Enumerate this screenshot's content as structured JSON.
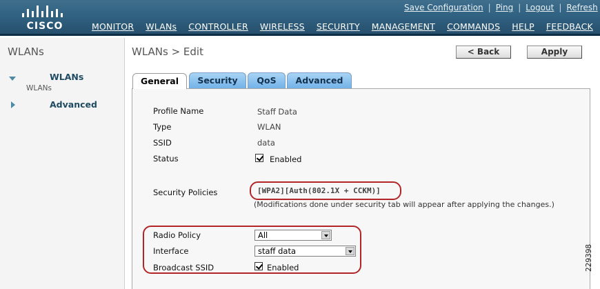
{
  "brand": {
    "logo_text": "CISCO"
  },
  "utility_links": [
    "Save Configuration",
    "Ping",
    "Logout",
    "Refresh"
  ],
  "main_nav": {
    "items": [
      "MONITOR",
      "WLANs",
      "CONTROLLER",
      "WIRELESS",
      "SECURITY",
      "MANAGEMENT",
      "COMMANDS",
      "HELP",
      "FEEDBACK"
    ],
    "active": "WLANs"
  },
  "sidebar": {
    "title": "WLANs",
    "items": [
      {
        "label": "WLANs",
        "sublabel": "WLANs",
        "expanded": true
      },
      {
        "label": "Advanced",
        "expanded": false
      }
    ]
  },
  "page": {
    "title": "WLANs > Edit",
    "back_label": "< Back",
    "apply_label": "Apply"
  },
  "tabs": {
    "items": [
      "General",
      "Security",
      "QoS",
      "Advanced"
    ],
    "active": "General"
  },
  "form": {
    "profile_name": {
      "label": "Profile Name",
      "value": "Staff Data"
    },
    "type": {
      "label": "Type",
      "value": "WLAN"
    },
    "ssid": {
      "label": "SSID",
      "value": "data"
    },
    "status": {
      "label": "Status",
      "checkbox_label": "Enabled",
      "checked": true
    },
    "security_policies": {
      "label": "Security Policies",
      "value": "[WPA2][Auth(802.1X + CCKM)]",
      "note": "(Modifications done under security tab will appear after applying the changes.)"
    },
    "radio_policy": {
      "label": "Radio Policy",
      "selected": "All"
    },
    "interface": {
      "label": "Interface",
      "selected": "staff data"
    },
    "broadcast_ssid": {
      "label": "Broadcast SSID",
      "checkbox_label": "Enabled",
      "checked": true
    }
  },
  "figure_number": "229398",
  "colors": {
    "header": "#2f5f7f",
    "annotation_oval": "#b22427",
    "tab_blue": "#8cc3ef"
  }
}
